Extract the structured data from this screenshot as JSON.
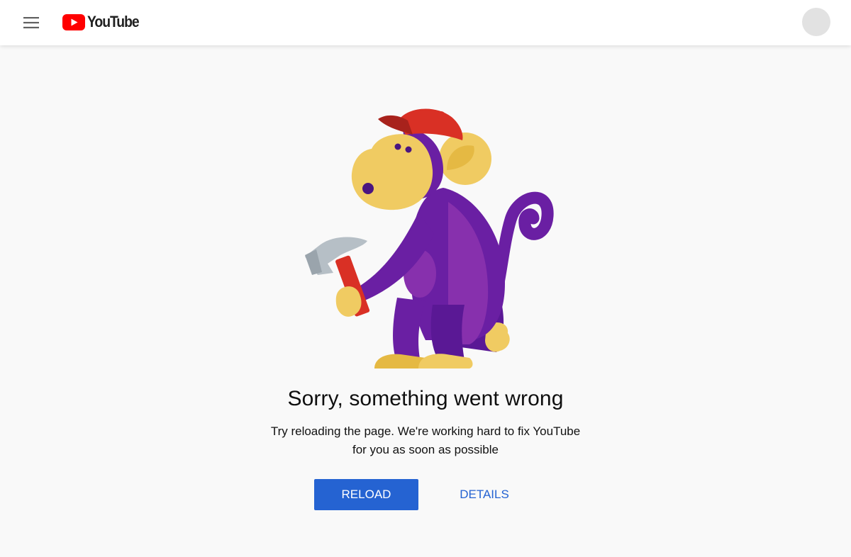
{
  "header": {
    "logo_text": "YouTube",
    "menu_icon": "hamburger-menu-icon",
    "avatar_icon": "account-avatar"
  },
  "error": {
    "illustration": "monkey-with-hammer",
    "title": "Sorry, something went wrong",
    "message_line1": "Try reloading the page. We're working hard to fix YouTube",
    "message_line2": "for you as soon as possible",
    "reload_label": "RELOAD",
    "details_label": "DETAILS"
  },
  "colors": {
    "brand_red": "#ff0000",
    "primary_blue": "#2563d2",
    "monkey_purple": "#6a1fa3",
    "monkey_yellow": "#f0cb62",
    "cap_red": "#d93025"
  }
}
